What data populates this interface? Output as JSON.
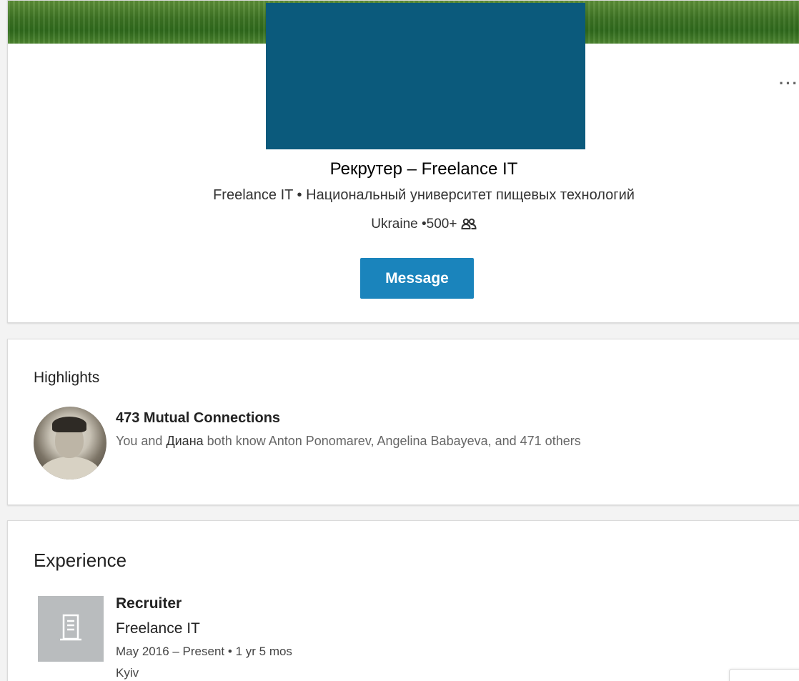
{
  "profile": {
    "headline_role": "Рекрутер",
    "headline_separator": "–",
    "headline_company": "Freelance IT",
    "current_company": "Freelance IT",
    "bullet": "•",
    "education": "Национальный университет пищевых технологий",
    "location": "Ukraine",
    "connections_count": "•500+",
    "message_button": "Message",
    "more_menu": "···"
  },
  "highlights": {
    "title": "Highlights",
    "mutual_title": "473 Mutual Connections",
    "mutual_desc_prefix": "You and",
    "mutual_desc_name": "Диана",
    "mutual_desc_suffix": "both know Anton Ponomarev, Angelina Babayeva, and 471 others"
  },
  "experience": {
    "title": "Experience",
    "items": [
      {
        "title": "Recruiter",
        "company": "Freelance IT",
        "dates": "May 2016 – Present",
        "duration": "1 yr 5 mos",
        "location": "Kyiv"
      }
    ]
  },
  "colors": {
    "accent": "#1a84bc",
    "redaction": "#0b5a7c",
    "logo_placeholder": "#b9bcbe"
  },
  "icons": {
    "connections": "people-icon",
    "company": "building-icon",
    "more": "ellipsis-icon"
  }
}
